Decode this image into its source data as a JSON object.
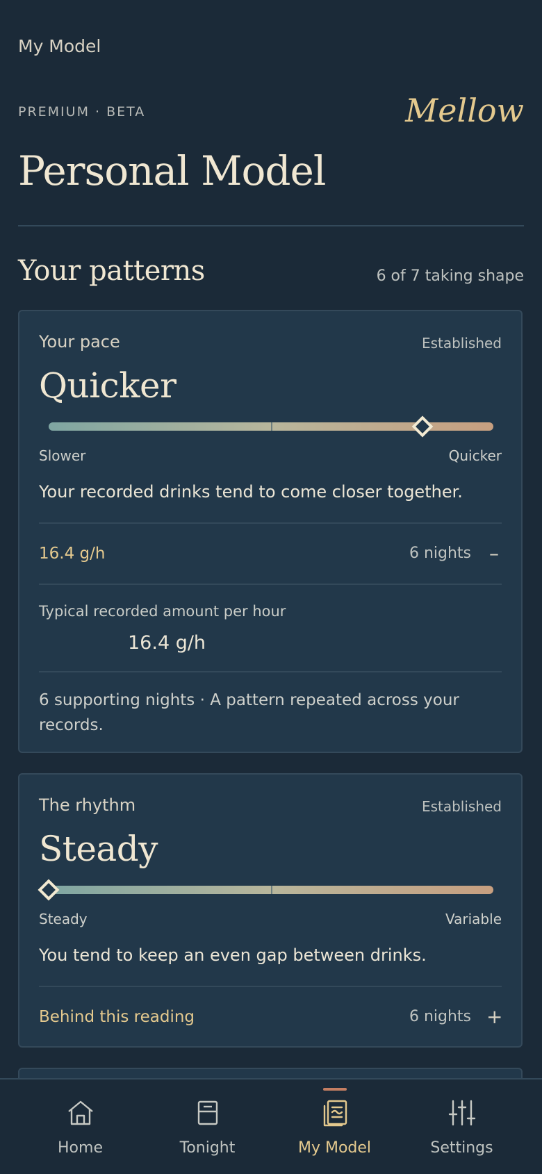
{
  "header": {
    "top_title": "My Model",
    "eyebrow": "PREMIUM · BETA",
    "brand": "Mellow",
    "page_title": "Personal Model"
  },
  "patterns": {
    "title": "Your patterns",
    "progress": "6 of 7 taking shape",
    "cards": [
      {
        "label": "Your pace",
        "status": "Established",
        "value": "Quicker",
        "scale_left": "Slower",
        "scale_right": "Quicker",
        "scale_position": 0.84,
        "description": "Your recorded drinks tend to come closer together.",
        "row_left": "16.4 g/h",
        "row_right": "6 nights",
        "toggle": "–",
        "expanded": true,
        "metric_label": "Typical recorded amount per hour",
        "metric_value": "16.4 g/h",
        "footnote": "6 supporting nights · A pattern repeated across your records."
      },
      {
        "label": "The rhythm",
        "status": "Established",
        "value": "Steady",
        "scale_left": "Steady",
        "scale_right": "Variable",
        "scale_position": 0.0,
        "description": "You tend to keep an even gap between drinks.",
        "row_left": "Behind this reading",
        "row_right": "6 nights",
        "toggle": "+",
        "expanded": false
      }
    ]
  },
  "tabs": [
    {
      "label": "Home",
      "icon": "home-icon",
      "active": false
    },
    {
      "label": "Tonight",
      "icon": "glass-icon",
      "active": false
    },
    {
      "label": "My Model",
      "icon": "model-book-icon",
      "active": true
    },
    {
      "label": "Settings",
      "icon": "sliders-icon",
      "active": false
    }
  ],
  "colors": {
    "background": "#1b2a38",
    "card": "#22384a",
    "accent_gold": "#e4c98e",
    "active_indicator": "#c47e62"
  }
}
